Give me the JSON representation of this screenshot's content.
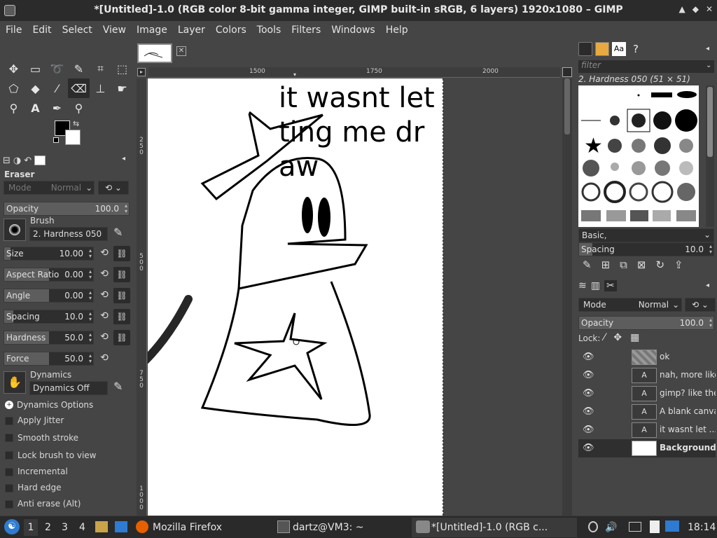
{
  "window": {
    "title": "*[Untitled]-1.0 (RGB color 8-bit gamma integer, GIMP built-in sRGB, 6 layers) 1920x1080 – GIMP",
    "buttons": [
      "▲",
      "◆",
      "✕"
    ]
  },
  "menu": [
    "File",
    "Edit",
    "Select",
    "View",
    "Image",
    "Layer",
    "Colors",
    "Tools",
    "Filters",
    "Windows",
    "Help"
  ],
  "tool_options": {
    "tool_name": "Eraser",
    "mode_label": "Mode",
    "mode_value": "Normal",
    "opacity_label": "Opacity",
    "opacity_value": "100.0",
    "brush_label": "Brush",
    "brush_value": "2. Hardness 050",
    "sliders": [
      {
        "label": "Size",
        "value": "10.00",
        "fill": 0.07
      },
      {
        "label": "Aspect Ratio",
        "value": "0.00",
        "fill": 0.5
      },
      {
        "label": "Angle",
        "value": "0.00",
        "fill": 0.5
      },
      {
        "label": "Spacing",
        "value": "10.0",
        "fill": 0.1
      },
      {
        "label": "Hardness",
        "value": "50.0",
        "fill": 0.5
      },
      {
        "label": "Force",
        "value": "50.0",
        "fill": 0.5
      }
    ],
    "dynamics_label": "Dynamics",
    "dynamics_value": "Dynamics Off",
    "dynamics_options": "Dynamics Options",
    "checks": [
      "Apply Jitter",
      "Smooth stroke",
      "Lock brush to view",
      "Incremental",
      "Hard edge",
      "Anti erase  (Alt)"
    ]
  },
  "ruler": {
    "h": [
      "1500",
      "1750",
      "2000"
    ],
    "v": [
      "2\n5\n0",
      "5\n0\n0",
      "7\n5\n0",
      "1\n0\n0\n0"
    ]
  },
  "canvas_text": [
    "it wasnt let",
    "ting me dr",
    "aw"
  ],
  "brushes": {
    "filter_placeholder": "filter",
    "selected": "2. Hardness 050 (51 × 51)",
    "set": "Basic,",
    "spacing_label": "Spacing",
    "spacing_value": "10.0"
  },
  "layers": {
    "mode_label": "Mode",
    "mode_value": "Normal",
    "opacity_label": "Opacity",
    "opacity_value": "100.0",
    "lock_label": "Lock:",
    "items": [
      {
        "name": "ok",
        "thumb": ""
      },
      {
        "name": "nah, more like",
        "thumb": "A"
      },
      {
        "name": "gimp? like the",
        "thumb": "A"
      },
      {
        "name": "A blank canva",
        "thumb": "A"
      },
      {
        "name": "it wasnt let ...",
        "thumb": "A"
      },
      {
        "name": "Background",
        "thumb": ""
      }
    ]
  },
  "taskbar": {
    "workspaces": [
      "1",
      "2",
      "3",
      "4"
    ],
    "firefox": "Mozilla Firefox",
    "terminal": "dartz@VM3: ~",
    "gimp": "*[Untitled]-1.0 (RGB c...",
    "clock": "18:14"
  }
}
